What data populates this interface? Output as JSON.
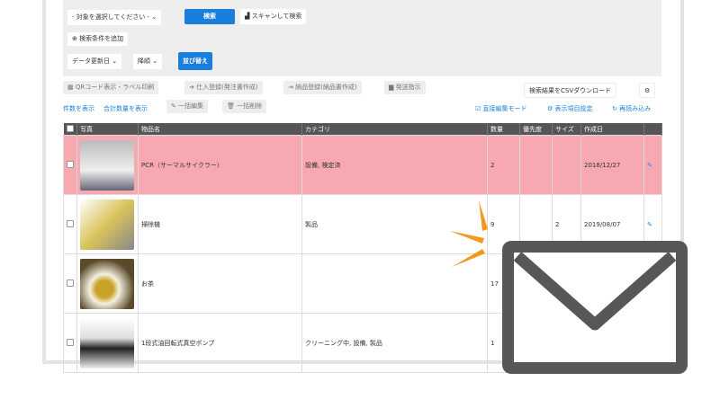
{
  "search": {
    "target_select": "- 対象を選択してください -",
    "search_button": "検索",
    "scan_button": "スキャンして検索",
    "add_condition": "検索条件を追加",
    "sort_field": "データ更新日",
    "sort_order": "降順",
    "sort_button": "並び替え"
  },
  "toolbar": {
    "qr_label": "QRコード表示・ラベル印刷",
    "purchase": "仕入登録(発注書作成)",
    "delivery": "納品登録(納品書作成)",
    "shipping": "発送指示",
    "csv_download": "検索結果をCSVダウンロード"
  },
  "actions": {
    "show_count": "件数を表示",
    "show_total": "合計数量を表示",
    "bulk_edit": "一括編集",
    "bulk_delete": "一括削除",
    "direct_edit": "直接編集モード",
    "display_settings": "表示項目設定",
    "reload": "再読み込み"
  },
  "table": {
    "headers": [
      "写真",
      "物品名",
      "カテゴリ",
      "数量",
      "優先度",
      "サイズ",
      "作成日"
    ],
    "rows": [
      {
        "name": "PCR（サーマルサイクラー）",
        "category": "設備, 検定済",
        "qty": "2",
        "priority": "",
        "size": "",
        "date": "2018/12/27",
        "highlight": true
      },
      {
        "name": "掃除機",
        "category": "製品",
        "qty": "9",
        "priority": "",
        "size": "2",
        "date": "2019/08/07"
      },
      {
        "name": "お茶",
        "category": "",
        "qty": "17",
        "priority": "",
        "size": "",
        "date": ""
      },
      {
        "name": "1段式油回転式真空ポンプ",
        "category": "クリーニング中, 設備, 製品",
        "qty": "1",
        "priority": "",
        "size": "",
        "date": ""
      }
    ]
  },
  "colors": {
    "accent": "#1a7fdc",
    "highlight_row": "#f7a8b1",
    "burst": "#f39a1e",
    "envelope": "#575757"
  },
  "icons": [
    "scan-icon",
    "plus-circle-icon",
    "qr-icon",
    "truck-icon",
    "gear-icon",
    "edit-icon",
    "trash-icon",
    "reload-icon",
    "pencil-icon",
    "envelope-icon"
  ]
}
